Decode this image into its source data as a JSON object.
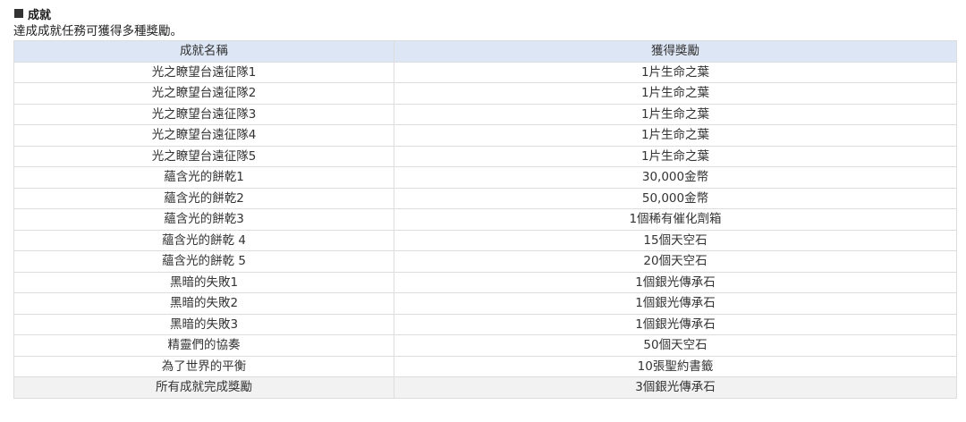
{
  "section": {
    "title": "成就",
    "description": "達成成就任務可獲得多種獎勵。"
  },
  "table": {
    "headers": [
      "成就名稱",
      "獲得獎勵"
    ],
    "rows": [
      [
        "光之瞭望台遠征隊1",
        "1片生命之葉"
      ],
      [
        "光之瞭望台遠征隊2",
        "1片生命之葉"
      ],
      [
        "光之瞭望台遠征隊3",
        "1片生命之葉"
      ],
      [
        "光之瞭望台遠征隊4",
        "1片生命之葉"
      ],
      [
        "光之瞭望台遠征隊5",
        "1片生命之葉"
      ],
      [
        "蘊含光的餅乾1",
        "30,000金幣"
      ],
      [
        "蘊含光的餅乾2",
        "50,000金幣"
      ],
      [
        "蘊含光的餅乾3",
        "1個稀有催化劑箱"
      ],
      [
        "蘊含光的餅乾 4",
        "15個天空石"
      ],
      [
        "蘊含光的餅乾 5",
        "20個天空石"
      ],
      [
        "黑暗的失敗1",
        "1個銀光傳承石"
      ],
      [
        "黑暗的失敗2",
        "1個銀光傳承石"
      ],
      [
        "黑暗的失敗3",
        "1個銀光傳承石"
      ],
      [
        "精靈們的協奏",
        "50個天空石"
      ],
      [
        "為了世界的平衡",
        "10張聖約書籤"
      ],
      [
        "所有成就完成獎勵",
        "3個銀光傳承石"
      ]
    ]
  },
  "colors": {
    "header_bg": "#dde6f5",
    "border": "#dddddd",
    "last_row_bg": "#f2f2f2",
    "text": "#333333"
  }
}
